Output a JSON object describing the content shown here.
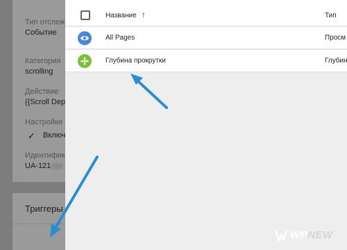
{
  "background_panel": {
    "fields": [
      {
        "label": "Тип отслеж",
        "value": "Событие"
      },
      {
        "label": "Категория",
        "value": "scrolling"
      },
      {
        "label": "Действие",
        "value": "{{Scroll Dept"
      },
      {
        "label": "Настройки",
        "value": ""
      },
      {
        "label": "Идентифика",
        "value": "UA-121"
      }
    ],
    "checkbox_label": "Включ",
    "triggers_title": "Триггеры"
  },
  "selector": {
    "header": {
      "name_label": "Название",
      "sort_icon": "↑",
      "type_label": "Тип"
    },
    "rows": [
      {
        "name": "All Pages",
        "type": "Просм",
        "icon": "eye-icon",
        "icon_color": "#4a87d9"
      },
      {
        "name": "Глубина прокрутки",
        "type": "Глубин",
        "icon": "scroll-move-icon",
        "icon_color": "#7cbd3c"
      }
    ]
  },
  "watermark": {
    "text_main": "WP",
    "text_tail": "NEW"
  },
  "colors": {
    "arrow": "#2a8fcf",
    "overlay_bg": "#eeeeef",
    "dim_bg": "#7d7d7d"
  }
}
